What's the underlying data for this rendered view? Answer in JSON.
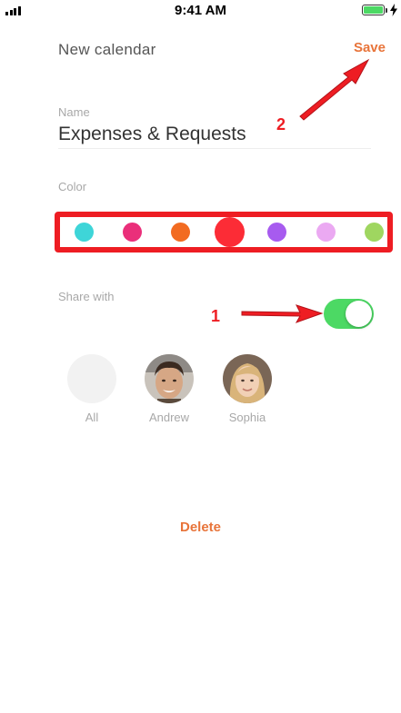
{
  "status_bar": {
    "time": "9:41 AM"
  },
  "header": {
    "title": "New calendar",
    "save_label": "Save"
  },
  "name_field": {
    "label": "Name",
    "value": "Expenses & Requests"
  },
  "color_section": {
    "label": "Color",
    "selected_index": 3,
    "swatches": [
      {
        "name": "cyan",
        "color": "#3ed5d8"
      },
      {
        "name": "pink",
        "color": "#ea2f7a"
      },
      {
        "name": "orange",
        "color": "#f26b21"
      },
      {
        "name": "red",
        "color": "#fc2c36"
      },
      {
        "name": "purple",
        "color": "#a75bef"
      },
      {
        "name": "light-pink",
        "color": "#eba9f2"
      },
      {
        "name": "green",
        "color": "#9fd660"
      }
    ]
  },
  "share_section": {
    "label": "Share with",
    "enabled": true,
    "users": [
      {
        "name": "All"
      },
      {
        "name": "Andrew"
      },
      {
        "name": "Sophia"
      }
    ]
  },
  "delete_label": "Delete",
  "annotations": {
    "step_1": "1",
    "step_2": "2",
    "color": "#ee1d23"
  },
  "colors": {
    "accent": "#e8743a",
    "toggle_on": "#4cd964"
  }
}
